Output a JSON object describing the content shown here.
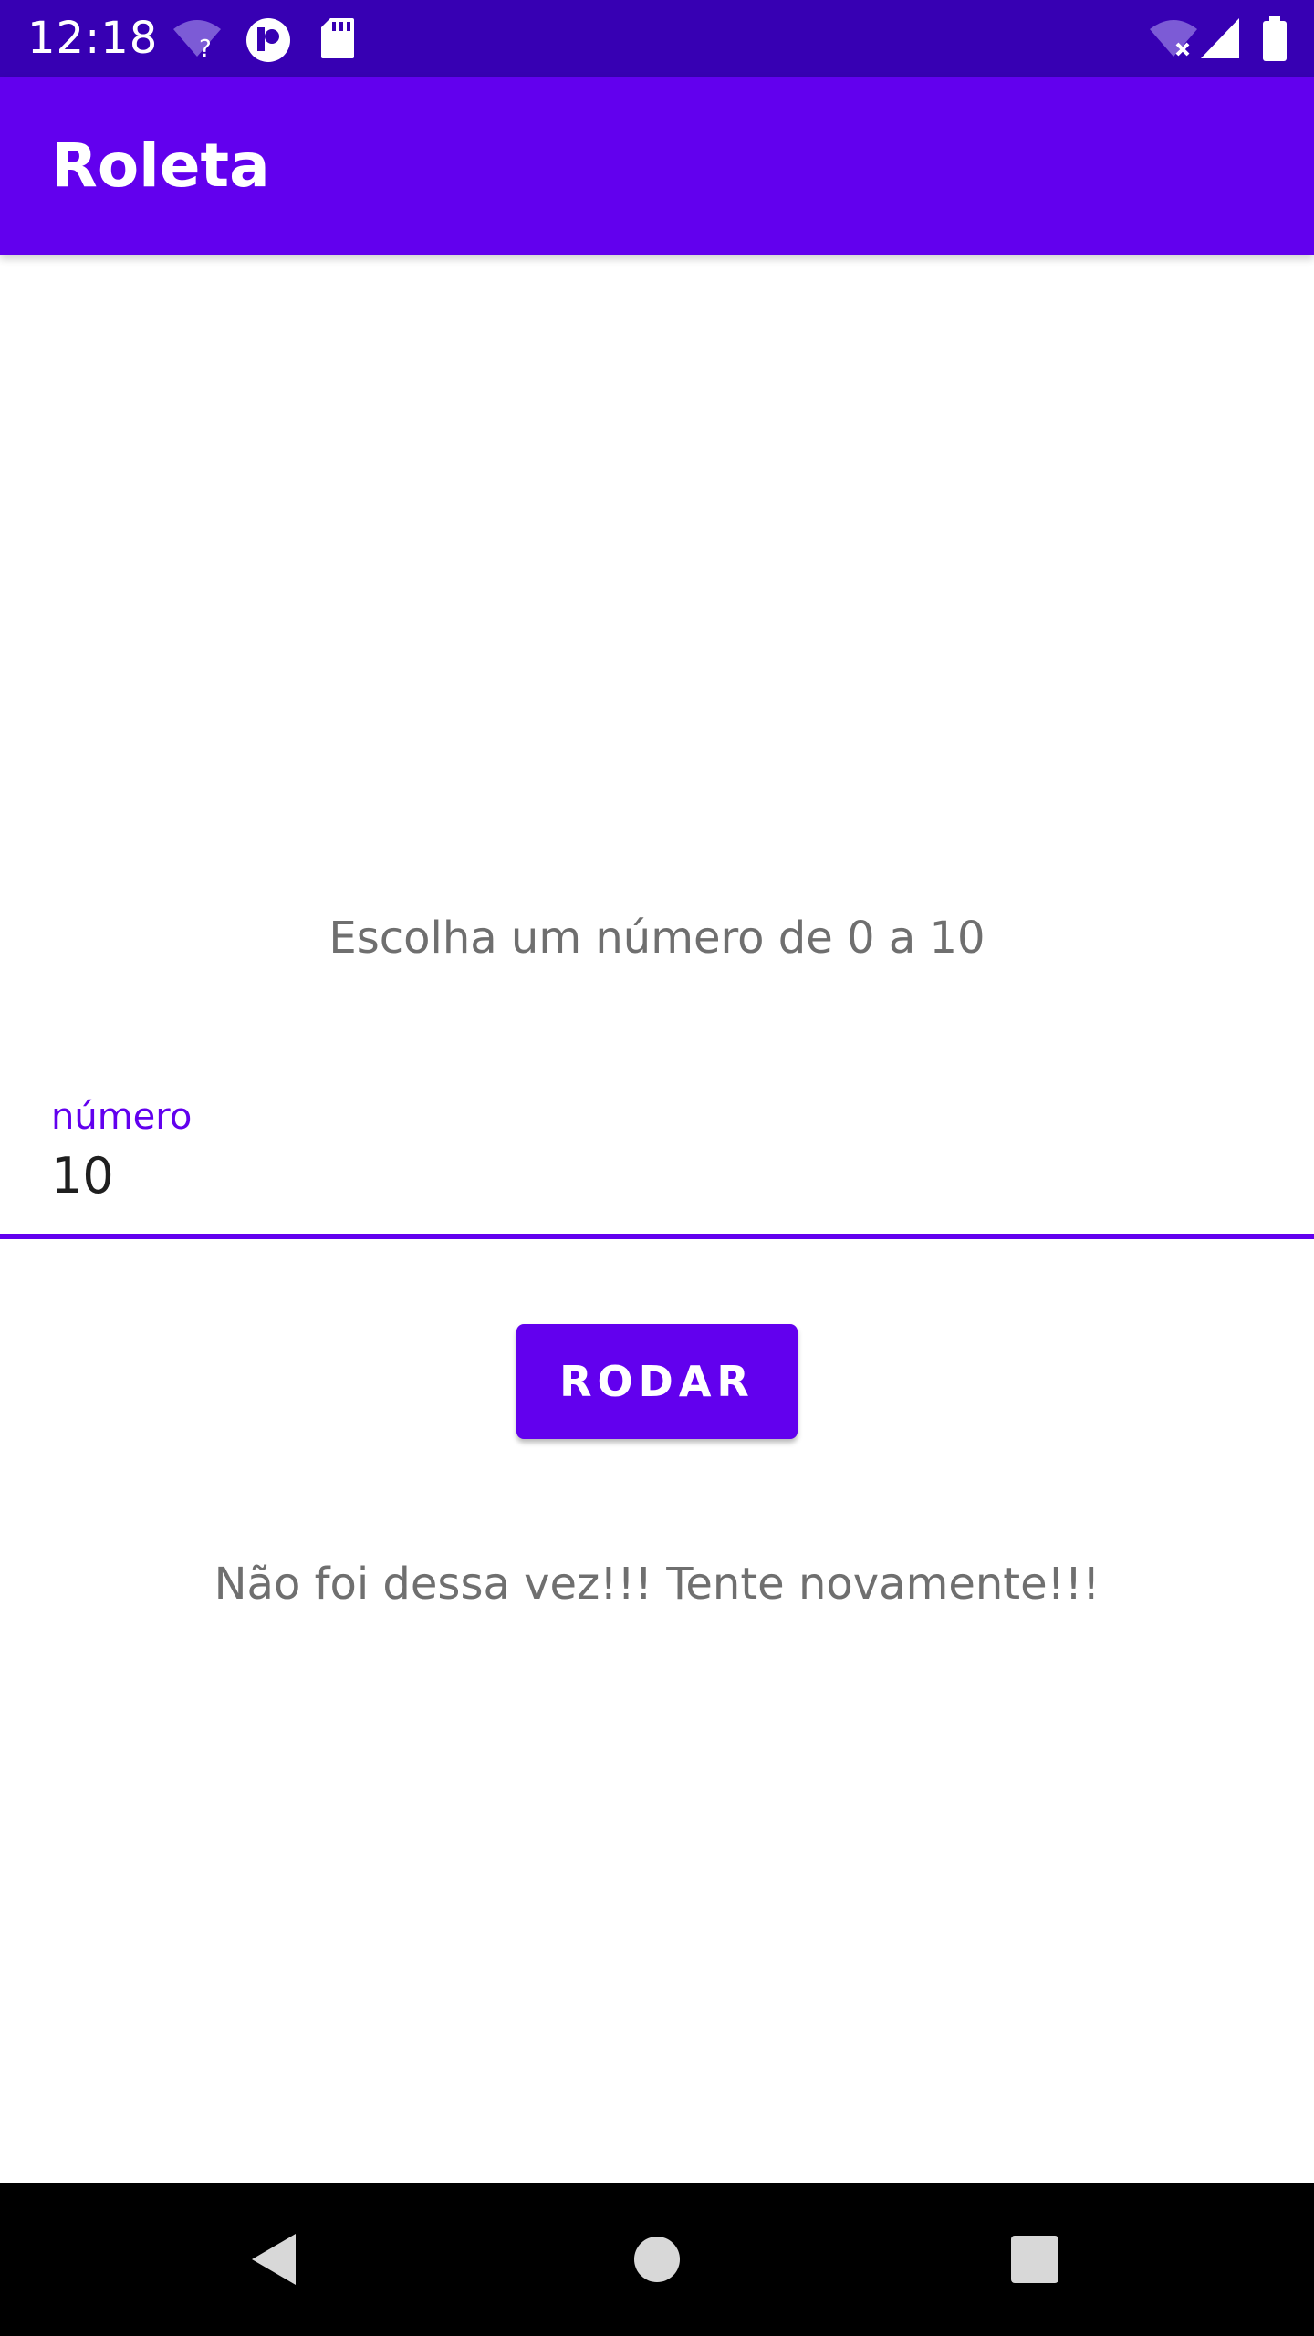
{
  "status_bar": {
    "time": "12:18",
    "left_icons": [
      "wifi-question-icon",
      "app-notification-icon",
      "sd-card-icon"
    ],
    "right_icons": [
      "wifi-x-icon",
      "cell-signal-icon",
      "battery-icon"
    ]
  },
  "app_bar": {
    "title": "Roleta"
  },
  "main": {
    "prompt": "Escolha um número de 0 a 10",
    "number_field": {
      "label": "número",
      "value": "10"
    },
    "spin_button_label": "RODAR",
    "result_message": "Não foi dessa vez!!! Tente novamente!!!"
  },
  "nav_bar": {
    "buttons": [
      "back-icon",
      "home-icon",
      "recents-icon"
    ]
  },
  "colors": {
    "status_bar": "#3700b3",
    "primary": "#6200ee",
    "text_secondary": "#6f6f6f",
    "text_primary": "#1f1f1f"
  }
}
